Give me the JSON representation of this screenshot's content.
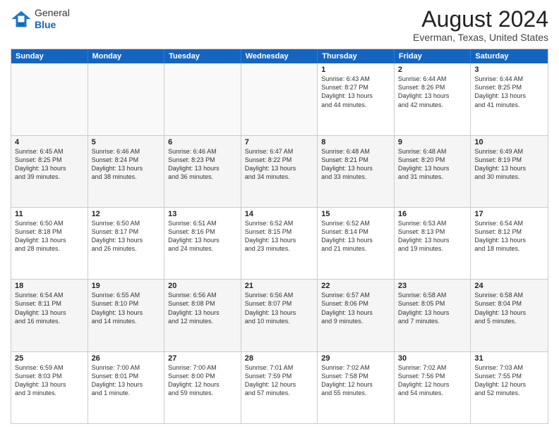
{
  "logo": {
    "general": "General",
    "blue": "Blue"
  },
  "title": "August 2024",
  "subtitle": "Everman, Texas, United States",
  "days": [
    "Sunday",
    "Monday",
    "Tuesday",
    "Wednesday",
    "Thursday",
    "Friday",
    "Saturday"
  ],
  "rows": [
    [
      {
        "day": "",
        "text": ""
      },
      {
        "day": "",
        "text": ""
      },
      {
        "day": "",
        "text": ""
      },
      {
        "day": "",
        "text": ""
      },
      {
        "day": "1",
        "text": "Sunrise: 6:43 AM\nSunset: 8:27 PM\nDaylight: 13 hours\nand 44 minutes."
      },
      {
        "day": "2",
        "text": "Sunrise: 6:44 AM\nSunset: 8:26 PM\nDaylight: 13 hours\nand 42 minutes."
      },
      {
        "day": "3",
        "text": "Sunrise: 6:44 AM\nSunset: 8:25 PM\nDaylight: 13 hours\nand 41 minutes."
      }
    ],
    [
      {
        "day": "4",
        "text": "Sunrise: 6:45 AM\nSunset: 8:25 PM\nDaylight: 13 hours\nand 39 minutes."
      },
      {
        "day": "5",
        "text": "Sunrise: 6:46 AM\nSunset: 8:24 PM\nDaylight: 13 hours\nand 38 minutes."
      },
      {
        "day": "6",
        "text": "Sunrise: 6:46 AM\nSunset: 8:23 PM\nDaylight: 13 hours\nand 36 minutes."
      },
      {
        "day": "7",
        "text": "Sunrise: 6:47 AM\nSunset: 8:22 PM\nDaylight: 13 hours\nand 34 minutes."
      },
      {
        "day": "8",
        "text": "Sunrise: 6:48 AM\nSunset: 8:21 PM\nDaylight: 13 hours\nand 33 minutes."
      },
      {
        "day": "9",
        "text": "Sunrise: 6:48 AM\nSunset: 8:20 PM\nDaylight: 13 hours\nand 31 minutes."
      },
      {
        "day": "10",
        "text": "Sunrise: 6:49 AM\nSunset: 8:19 PM\nDaylight: 13 hours\nand 30 minutes."
      }
    ],
    [
      {
        "day": "11",
        "text": "Sunrise: 6:50 AM\nSunset: 8:18 PM\nDaylight: 13 hours\nand 28 minutes."
      },
      {
        "day": "12",
        "text": "Sunrise: 6:50 AM\nSunset: 8:17 PM\nDaylight: 13 hours\nand 26 minutes."
      },
      {
        "day": "13",
        "text": "Sunrise: 6:51 AM\nSunset: 8:16 PM\nDaylight: 13 hours\nand 24 minutes."
      },
      {
        "day": "14",
        "text": "Sunrise: 6:52 AM\nSunset: 8:15 PM\nDaylight: 13 hours\nand 23 minutes."
      },
      {
        "day": "15",
        "text": "Sunrise: 6:52 AM\nSunset: 8:14 PM\nDaylight: 13 hours\nand 21 minutes."
      },
      {
        "day": "16",
        "text": "Sunrise: 6:53 AM\nSunset: 8:13 PM\nDaylight: 13 hours\nand 19 minutes."
      },
      {
        "day": "17",
        "text": "Sunrise: 6:54 AM\nSunset: 8:12 PM\nDaylight: 13 hours\nand 18 minutes."
      }
    ],
    [
      {
        "day": "18",
        "text": "Sunrise: 6:54 AM\nSunset: 8:11 PM\nDaylight: 13 hours\nand 16 minutes."
      },
      {
        "day": "19",
        "text": "Sunrise: 6:55 AM\nSunset: 8:10 PM\nDaylight: 13 hours\nand 14 minutes."
      },
      {
        "day": "20",
        "text": "Sunrise: 6:56 AM\nSunset: 8:08 PM\nDaylight: 13 hours\nand 12 minutes."
      },
      {
        "day": "21",
        "text": "Sunrise: 6:56 AM\nSunset: 8:07 PM\nDaylight: 13 hours\nand 10 minutes."
      },
      {
        "day": "22",
        "text": "Sunrise: 6:57 AM\nSunset: 8:06 PM\nDaylight: 13 hours\nand 9 minutes."
      },
      {
        "day": "23",
        "text": "Sunrise: 6:58 AM\nSunset: 8:05 PM\nDaylight: 13 hours\nand 7 minutes."
      },
      {
        "day": "24",
        "text": "Sunrise: 6:58 AM\nSunset: 8:04 PM\nDaylight: 13 hours\nand 5 minutes."
      }
    ],
    [
      {
        "day": "25",
        "text": "Sunrise: 6:59 AM\nSunset: 8:03 PM\nDaylight: 13 hours\nand 3 minutes."
      },
      {
        "day": "26",
        "text": "Sunrise: 7:00 AM\nSunset: 8:01 PM\nDaylight: 13 hours\nand 1 minute."
      },
      {
        "day": "27",
        "text": "Sunrise: 7:00 AM\nSunset: 8:00 PM\nDaylight: 12 hours\nand 59 minutes."
      },
      {
        "day": "28",
        "text": "Sunrise: 7:01 AM\nSunset: 7:59 PM\nDaylight: 12 hours\nand 57 minutes."
      },
      {
        "day": "29",
        "text": "Sunrise: 7:02 AM\nSunset: 7:58 PM\nDaylight: 12 hours\nand 55 minutes."
      },
      {
        "day": "30",
        "text": "Sunrise: 7:02 AM\nSunset: 7:56 PM\nDaylight: 12 hours\nand 54 minutes."
      },
      {
        "day": "31",
        "text": "Sunrise: 7:03 AM\nSunset: 7:55 PM\nDaylight: 12 hours\nand 52 minutes."
      }
    ]
  ]
}
